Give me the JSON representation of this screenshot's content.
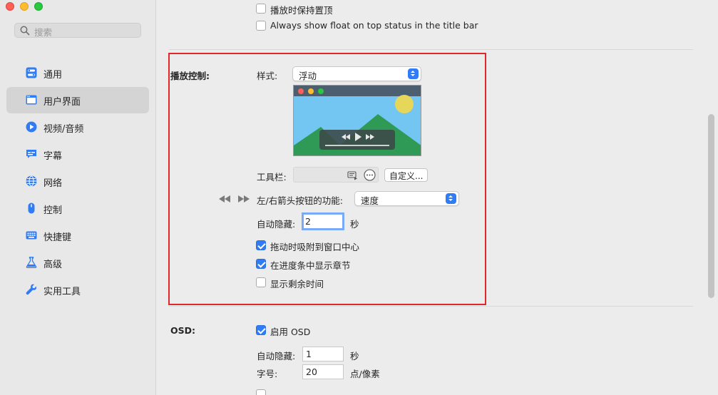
{
  "sidebar": {
    "search_placeholder": "搜索",
    "items": [
      {
        "label": "通用",
        "icon": "toggles-icon"
      },
      {
        "label": "用户界面",
        "icon": "window-icon"
      },
      {
        "label": "视频/音频",
        "icon": "play-circle-icon"
      },
      {
        "label": "字幕",
        "icon": "captions-icon"
      },
      {
        "label": "网络",
        "icon": "globe-icon"
      },
      {
        "label": "控制",
        "icon": "mouse-icon"
      },
      {
        "label": "快捷键",
        "icon": "keyboard-icon"
      },
      {
        "label": "高级",
        "icon": "flask-icon"
      },
      {
        "label": "实用工具",
        "icon": "wrench-icon"
      }
    ],
    "selected_index": 1
  },
  "top": {
    "keep_on_top_label": "播放时保持置顶",
    "always_show_float_label": "Always show float on top status in the title bar"
  },
  "playback": {
    "section_label": "播放控制:",
    "style_label": "样式:",
    "style_value": "浮动",
    "toolbar_label": "工具栏:",
    "customize_label": "自定义...",
    "arrow_label": "左/右箭头按钮的功能:",
    "arrow_value": "速度",
    "autohide_label": "自动隐藏:",
    "autohide_value": "2",
    "autohide_unit": "秒",
    "snap_center_label": "拖动时吸附到窗口中心",
    "snap_center_checked": true,
    "show_chapters_label": "在进度条中显示章节",
    "show_chapters_checked": true,
    "show_remaining_label": "显示剩余时间",
    "show_remaining_checked": false
  },
  "osd": {
    "section_label": "OSD:",
    "enable_label": "启用 OSD",
    "enable_checked": true,
    "autohide_label": "自动隐藏:",
    "autohide_value": "1",
    "autohide_unit": "秒",
    "fontsize_label": "字号:",
    "fontsize_value": "20",
    "fontsize_unit": "点/像素"
  },
  "colors": {
    "accent": "#2f7cf6",
    "highlight_box": "#e0282c"
  }
}
